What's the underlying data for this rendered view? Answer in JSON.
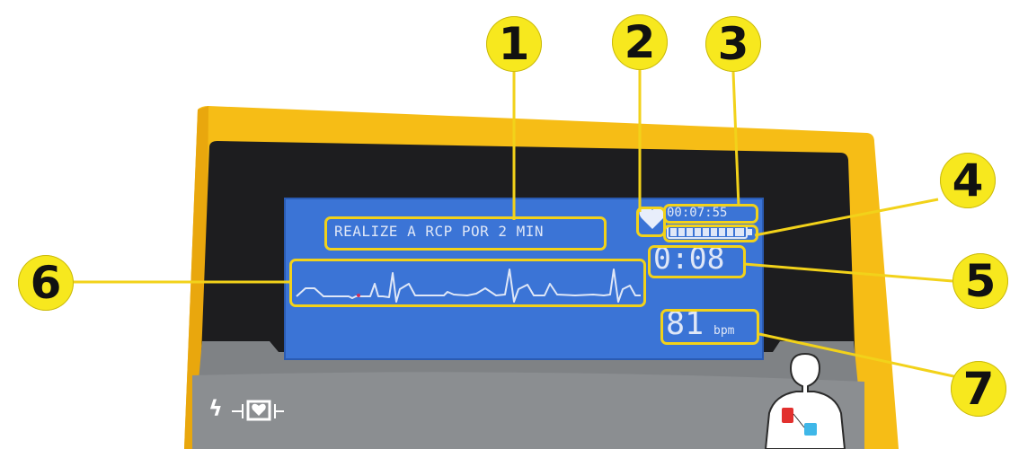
{
  "screen": {
    "message": "REALIZE A RCP POR 2 MIN",
    "elapsed_time": "00:07:55",
    "cpr_timer": "0:08",
    "heart_rate_value": "81",
    "heart_rate_unit": "bpm"
  },
  "callouts": [
    "1",
    "2",
    "3",
    "4",
    "5",
    "6",
    "7"
  ],
  "device": {
    "shock_symbol": "ϟ"
  },
  "icons": {
    "heart": "heart-icon",
    "battery": "battery-icon",
    "defib": "defibrillator-symbol-icon",
    "pad_placement": "pad-placement-figure-icon"
  },
  "colors": {
    "device_body": "#f6bd16",
    "lcd_background": "#3b74d6",
    "highlight": "#f2d21a",
    "callout": "#f7e81e",
    "panel": "#7f8285"
  },
  "battery_level": 1.0
}
